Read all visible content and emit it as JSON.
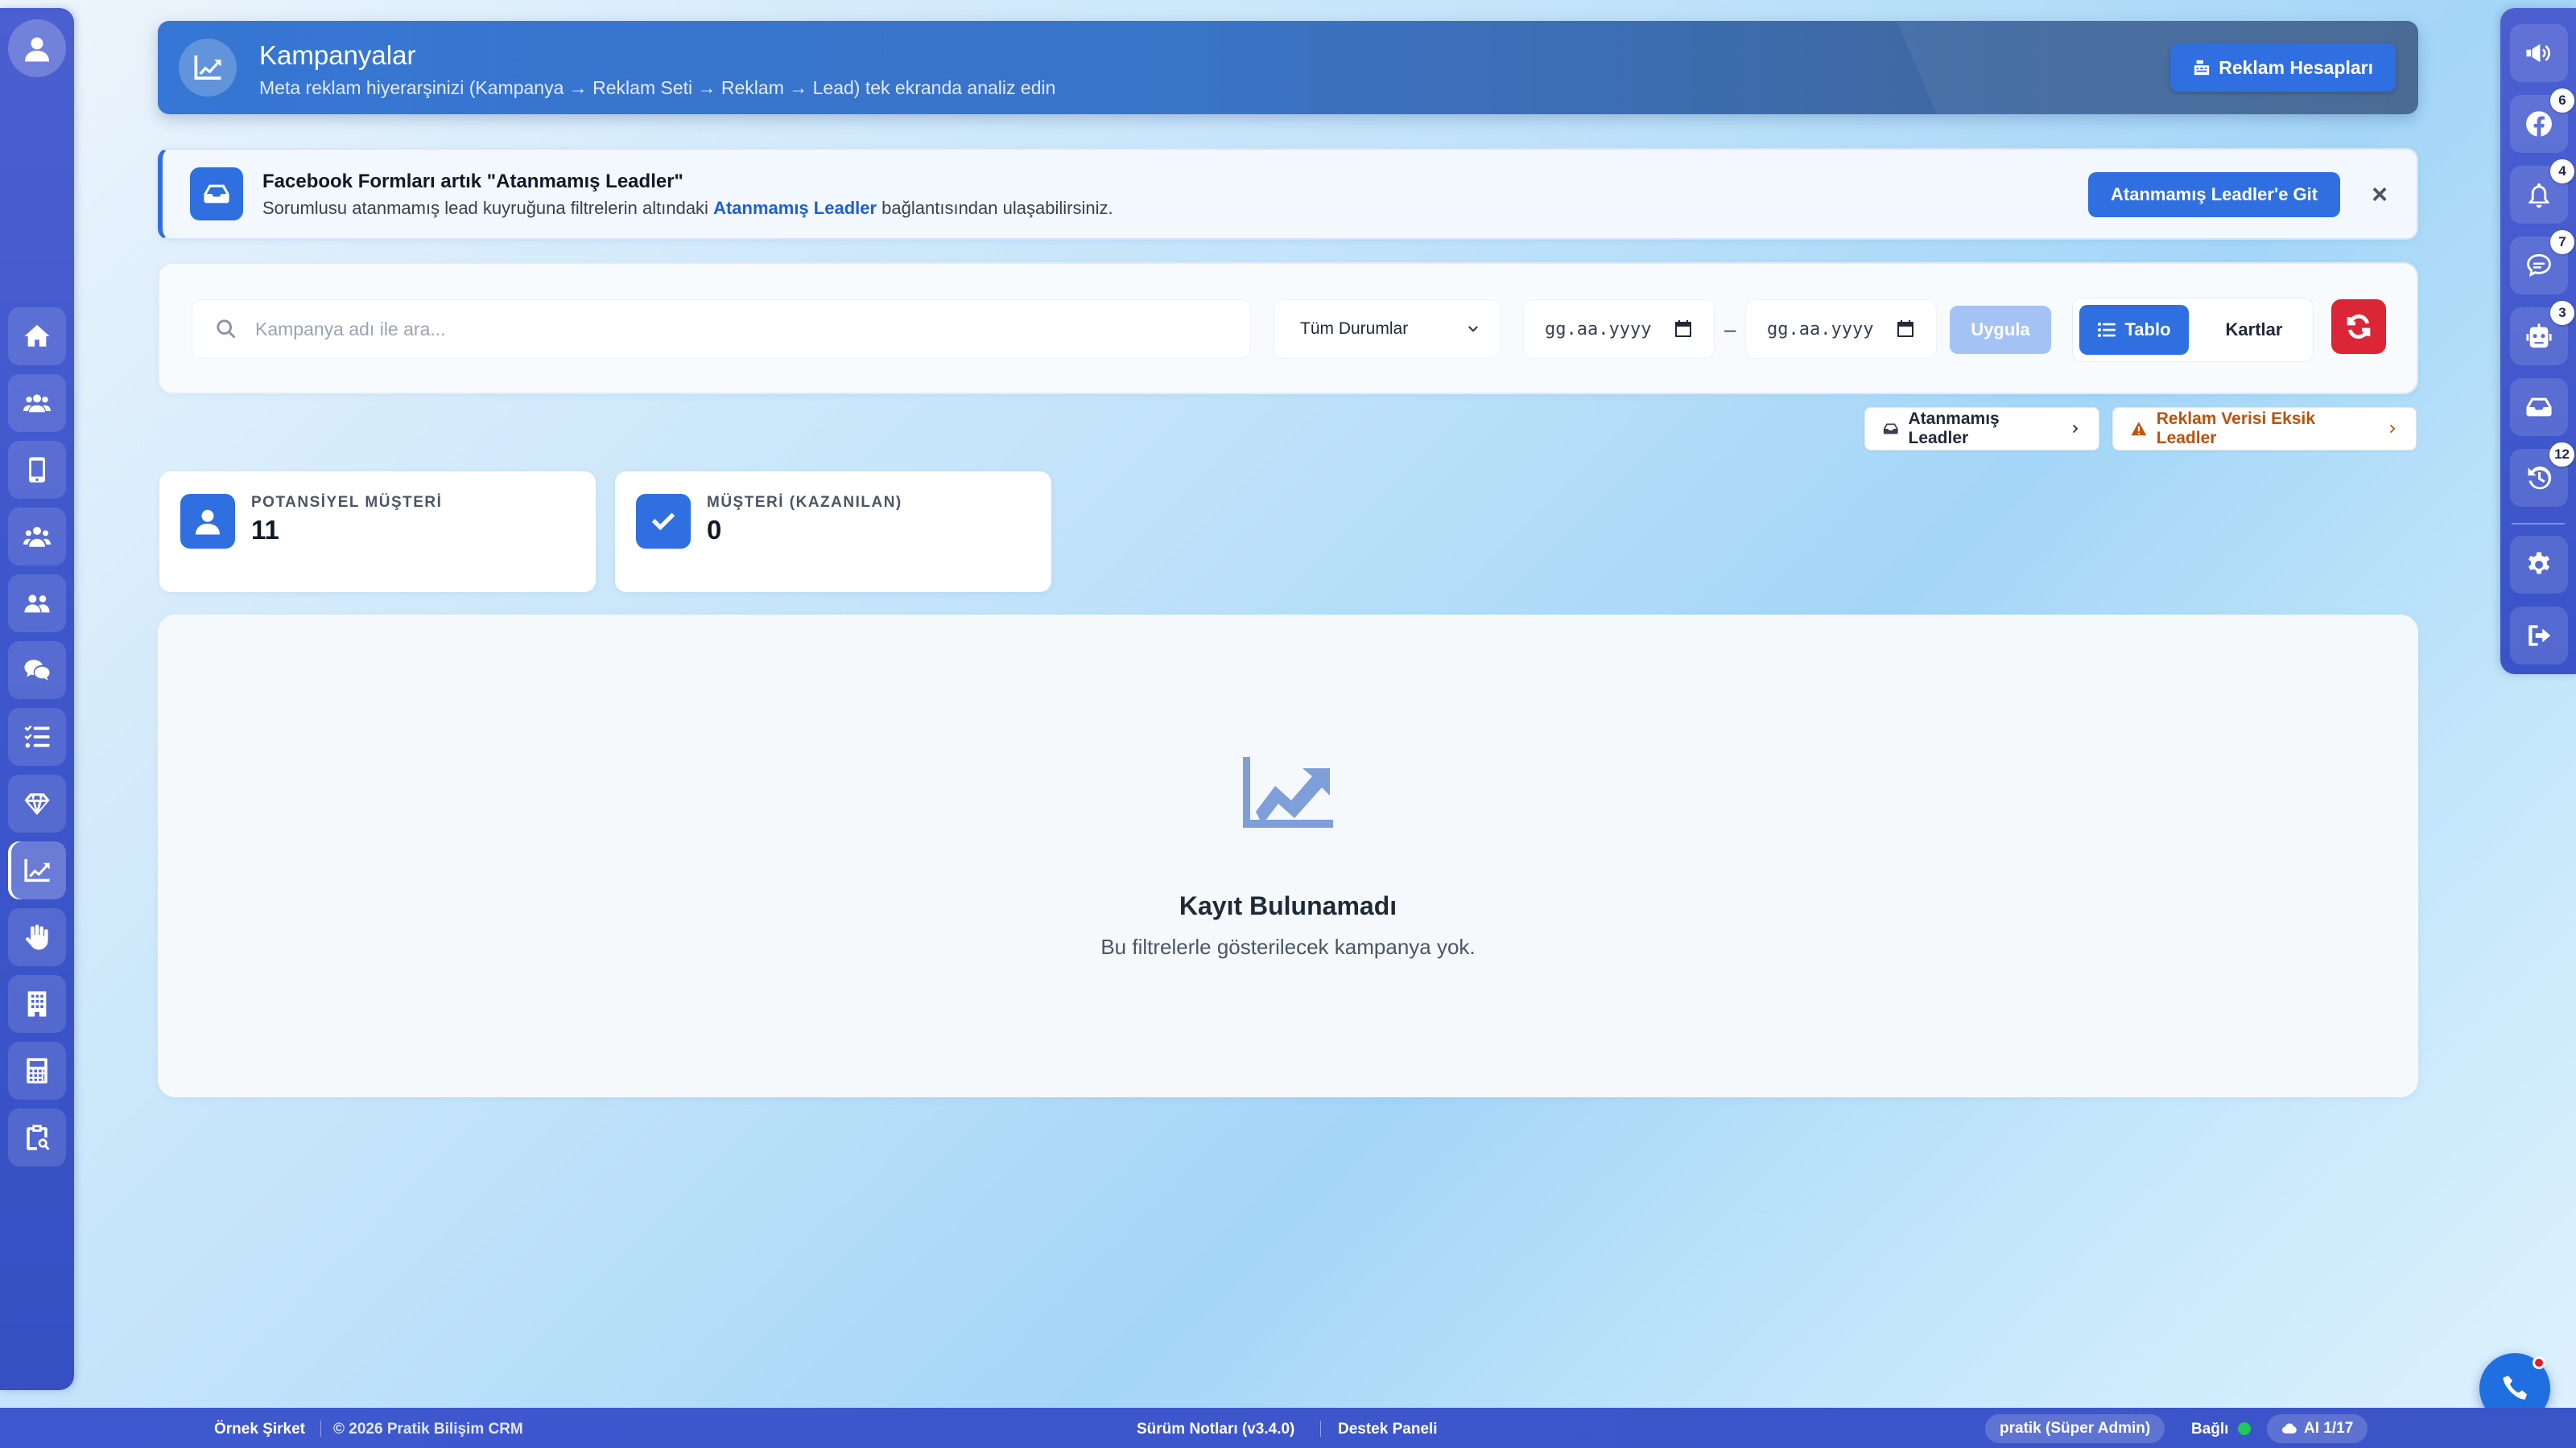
{
  "header": {
    "title": "Kampanyalar",
    "subtitle": "Meta reklam hiyerarşinizi (Kampanya → Reklam Seti → Reklam → Lead) tek ekranda analiz edin",
    "ad_accounts_button": "Reklam Hesapları",
    "icon": "chart-line-icon"
  },
  "notice": {
    "title": "Facebook Formları artık \"Atanmamış Leadler\"",
    "text_before": "Sorumlusu atanmamış lead kuyruğuna filtrelerin altındaki",
    "link": "Atanmamış Leadler",
    "text_after": "bağlantısından ulaşabilirsiniz.",
    "button": "Atanmamış Leadler'e Git",
    "close": "×",
    "icon": "inbox-icon"
  },
  "filters": {
    "search_placeholder": "Kampanya adı ile ara...",
    "status_selected": "Tüm Durumlar",
    "date_start_placeholder": "gg.aa.yyyy",
    "date_end_placeholder": "gg.aa.yyyy",
    "date_separator": "–",
    "apply_button": "Uygula",
    "view_table": "Tablo",
    "view_cards": "Kartlar",
    "active_view": "Tablo"
  },
  "quick_links": {
    "unassigned": "Atanmamış Leadler",
    "missing_ad_data": "Reklam Verisi Eksik Leadler"
  },
  "stats": [
    {
      "label": "POTANSİYEL MÜŞTERİ",
      "value": "11",
      "icon": "user-icon"
    },
    {
      "label": "MÜŞTERİ (KAZANILAN)",
      "value": "0",
      "icon": "check-icon"
    }
  ],
  "empty_state": {
    "title": "Kayıt Bulunamadı",
    "subtitle": "Bu filtrelerle gösterilecek kampanya yok.",
    "icon": "chart-area-icon"
  },
  "left_sidebar": {
    "items": [
      "home-icon",
      "users-icon",
      "mobile-icon",
      "users-cog-icon",
      "user-group-icon",
      "chat-icon",
      "task-list-icon",
      "diamond-icon",
      "chart-line-icon",
      "hand-icon",
      "building-icon",
      "calculator-icon",
      "clipboard-search-icon"
    ],
    "active": "chart-line-icon"
  },
  "right_sidebar": {
    "items": [
      {
        "icon": "megaphone-icon",
        "badge": ""
      },
      {
        "icon": "facebook-icon",
        "badge": "6"
      },
      {
        "icon": "bell-icon",
        "badge": "4"
      },
      {
        "icon": "comment-icon",
        "badge": "7"
      },
      {
        "icon": "robot-icon",
        "badge": "3"
      },
      {
        "icon": "inbox-icon",
        "badge": ""
      },
      {
        "icon": "history-icon",
        "badge": "12"
      },
      {
        "icon": "gear-icon",
        "badge": ""
      },
      {
        "icon": "logout-icon",
        "badge": ""
      }
    ]
  },
  "footer": {
    "company": "Örnek Şirket",
    "copyright": "© 2026 Pratik Bilişim CRM",
    "release_notes": "Sürüm Notları (v3.4.0)",
    "support": "Destek Paneli",
    "user": "pratik (Süper Admin)",
    "connection": "Bağlı",
    "ai_usage": "AI 1/17"
  },
  "colors": {
    "primary": "#2f6fe0",
    "sidebar": "#3f57cc",
    "danger": "#dc2638",
    "warning_text": "#b8520c",
    "online": "#22c55e"
  }
}
